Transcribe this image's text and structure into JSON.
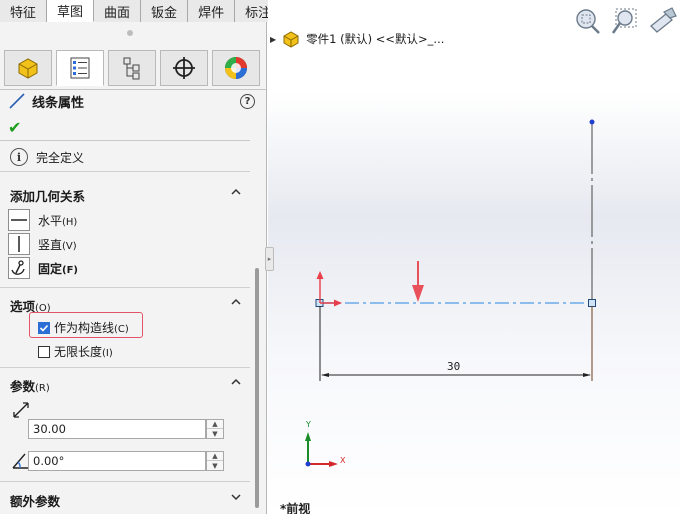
{
  "tabs": [
    "特征",
    "草图",
    "曲面",
    "钣金",
    "焊件",
    "标注"
  ],
  "active_tab": "草图",
  "panel": {
    "title": "线条属性",
    "help": "?",
    "message": "完全定义",
    "relations": {
      "header": "添加几何关系",
      "items": [
        {
          "label": "水平",
          "shortcut": "(H)",
          "bold": false
        },
        {
          "label": "竖直",
          "shortcut": "(V)",
          "bold": false
        },
        {
          "label": "固定",
          "shortcut": "(F)",
          "bold": true
        }
      ]
    },
    "options": {
      "header": "选项",
      "header_shortcut": "(O)",
      "construction": {
        "label": "作为构造线",
        "shortcut": "(C)",
        "checked": true
      },
      "infinite": {
        "label": "无限长度",
        "shortcut": "(I)",
        "checked": false
      }
    },
    "params": {
      "header": "参数",
      "header_shortcut": "(R)",
      "length": "30.00",
      "angle": "0.00°"
    },
    "extra": {
      "header": "额外参数"
    }
  },
  "tree": {
    "label": "零件1 (默认) <<默认>_..."
  },
  "viewport": {
    "dimension": "30",
    "axis_x": "X",
    "axis_y": "Y",
    "view_name": "*前视"
  },
  "colors": {
    "construction_line": "#6aa9e8",
    "dimension": "#222222",
    "accent_red": "#e8404a",
    "highlight": "#e25568"
  }
}
